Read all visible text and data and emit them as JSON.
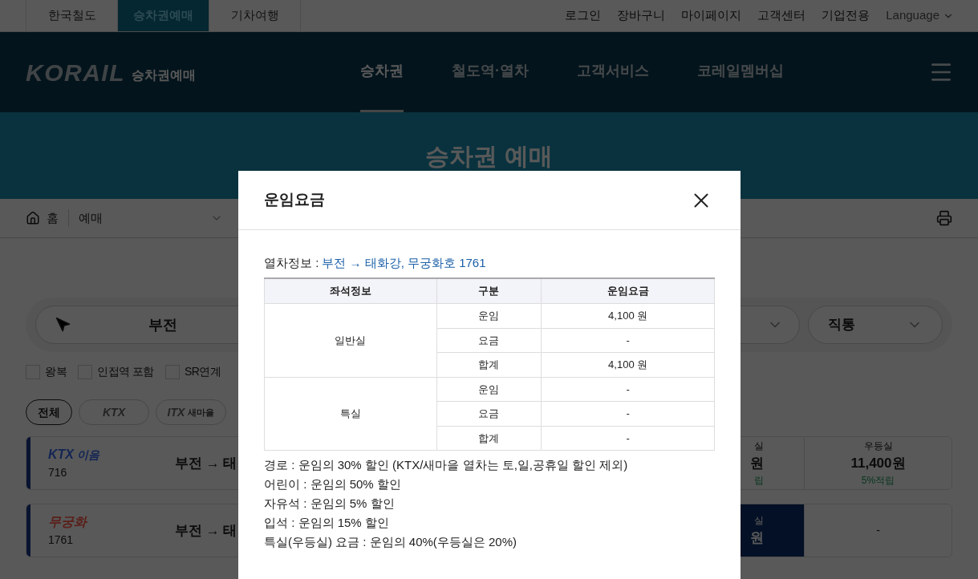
{
  "top_bar": {
    "tabs": [
      {
        "label": "한국철도",
        "selected": false
      },
      {
        "label": "승차권예매",
        "selected": true
      },
      {
        "label": "기차여행",
        "selected": false
      }
    ],
    "links": [
      "로그인",
      "장바구니",
      "마이페이지",
      "고객센터",
      "기업전용"
    ],
    "language": "Language"
  },
  "header": {
    "logo": "KORAIL",
    "logo_sub": "승차권예매",
    "nav": [
      {
        "label": "승차권",
        "selected": true
      },
      {
        "label": "철도역·열차",
        "selected": false
      },
      {
        "label": "고객서비스",
        "selected": false
      },
      {
        "label": "코레일멤버십",
        "selected": false
      }
    ]
  },
  "banner": {
    "title": "승차권 예매"
  },
  "breadcrumb": {
    "home": "홈",
    "current": "예매"
  },
  "search": {
    "departure": "부전",
    "type": "직통"
  },
  "options": [
    {
      "label": "왕복",
      "checked": false
    },
    {
      "label": "인접역 포함",
      "checked": false
    },
    {
      "label": "SR연계",
      "checked": false
    }
  ],
  "filters": [
    {
      "label": "전체",
      "selected": true
    },
    {
      "label": "KTX",
      "selected": false
    },
    {
      "label": "ITX",
      "sub": "새마을",
      "selected": false
    }
  ],
  "trains": [
    {
      "kind": "ktx",
      "name": "KTX",
      "name_sub": "이음",
      "number": "716",
      "route": "부전 → 태",
      "fares": [
        {
          "kind": "fare",
          "label": "실",
          "price": "원",
          "note": "립",
          "selected": false
        },
        {
          "kind": "fare",
          "label": "우등실",
          "price": "11,400원",
          "note": "5%적립",
          "selected": false
        }
      ]
    },
    {
      "kind": "mugunghwa",
      "name": "무궁화",
      "number": "1761",
      "route": "부전 → 태",
      "fares": [
        {
          "kind": "fare",
          "label": "실",
          "price": "원",
          "selected": true
        },
        {
          "kind": "empty",
          "label": "-",
          "selected": false
        }
      ]
    }
  ],
  "modal": {
    "title": "운임요금",
    "info_label": "열차정보 :",
    "info": "부전 → 태화강, 무궁화호 1761",
    "table": {
      "columns": [
        "좌석정보",
        "구분",
        "운임요금"
      ],
      "groups": [
        {
          "seat": "일반실",
          "rows": [
            {
              "type": "운임",
              "fare": "4,100 원"
            },
            {
              "type": "요금",
              "fare": "-"
            },
            {
              "type": "합계",
              "fare": "4,100 원"
            }
          ]
        },
        {
          "seat": "특실",
          "rows": [
            {
              "type": "운임",
              "fare": "-"
            },
            {
              "type": "요금",
              "fare": "-"
            },
            {
              "type": "합계",
              "fare": "-"
            }
          ]
        }
      ]
    },
    "notes": [
      "경로 : 운임의 30% 할인 (KTX/새마을 열차는 토,일,공휴일 할인 제외)",
      "어린이 : 운임의 50% 할인",
      "자유석 : 운임의 5% 할인",
      "입석 : 운임의 15% 할인",
      "특실(우등실) 요금 : 운임의 40%(우등실은 20%)"
    ]
  }
}
